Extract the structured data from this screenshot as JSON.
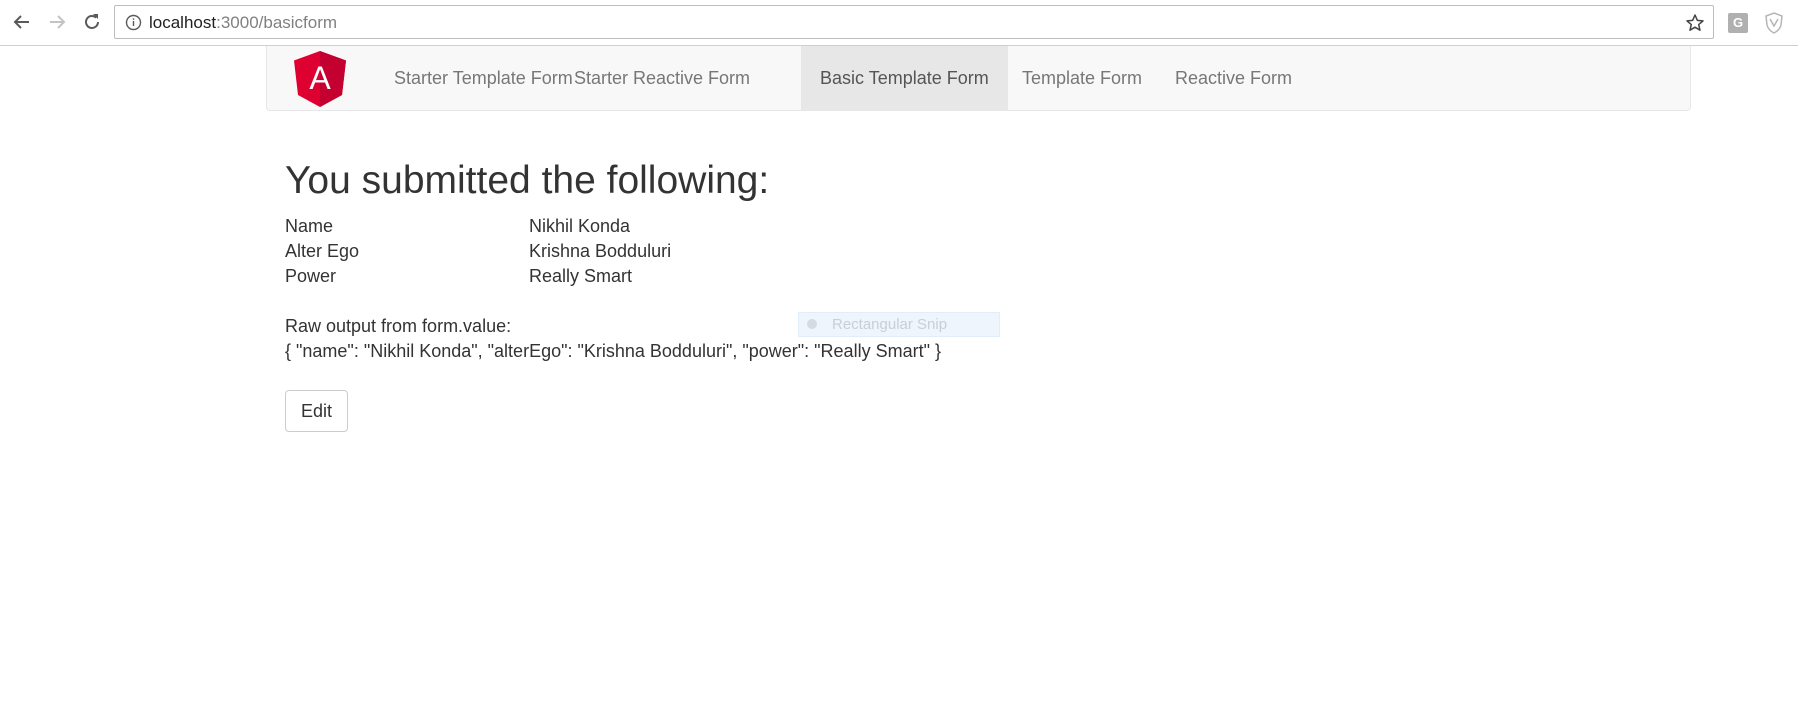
{
  "browser": {
    "url_host": "localhost",
    "url_rest": ":3000/basicform"
  },
  "navbar": {
    "links": [
      {
        "label": "Starter Template Form",
        "active": false
      },
      {
        "label": "Starter Reactive Form",
        "active": false
      },
      {
        "label": "Basic Template Form",
        "active": true
      },
      {
        "label": "Template Form",
        "active": false
      },
      {
        "label": "Reactive Form",
        "active": false
      }
    ]
  },
  "logo_letter": "A",
  "colors": {
    "logo_red": "#dd0031",
    "logo_dark_red": "#c3002f",
    "nav_bg": "#f8f8f8",
    "nav_active_bg": "#e7e7e7",
    "text": "#333333"
  },
  "main": {
    "heading": "You submitted the following:",
    "summary": [
      {
        "label": "Name",
        "value": "Nikhil Konda"
      },
      {
        "label": "Alter Ego",
        "value": "Krishna Bodduluri"
      },
      {
        "label": "Power",
        "value": "Really Smart"
      }
    ],
    "raw_label": "Raw output from form.value:",
    "raw_json": "{ \"name\": \"Nikhil Konda\", \"alterEgo\": \"Krishna Bodduluri\", \"power\": \"Really Smart\" }",
    "edit_label": "Edit"
  },
  "overlay": {
    "snip_label": "Rectangular Snip"
  },
  "extensions": {
    "g_label": "G"
  }
}
